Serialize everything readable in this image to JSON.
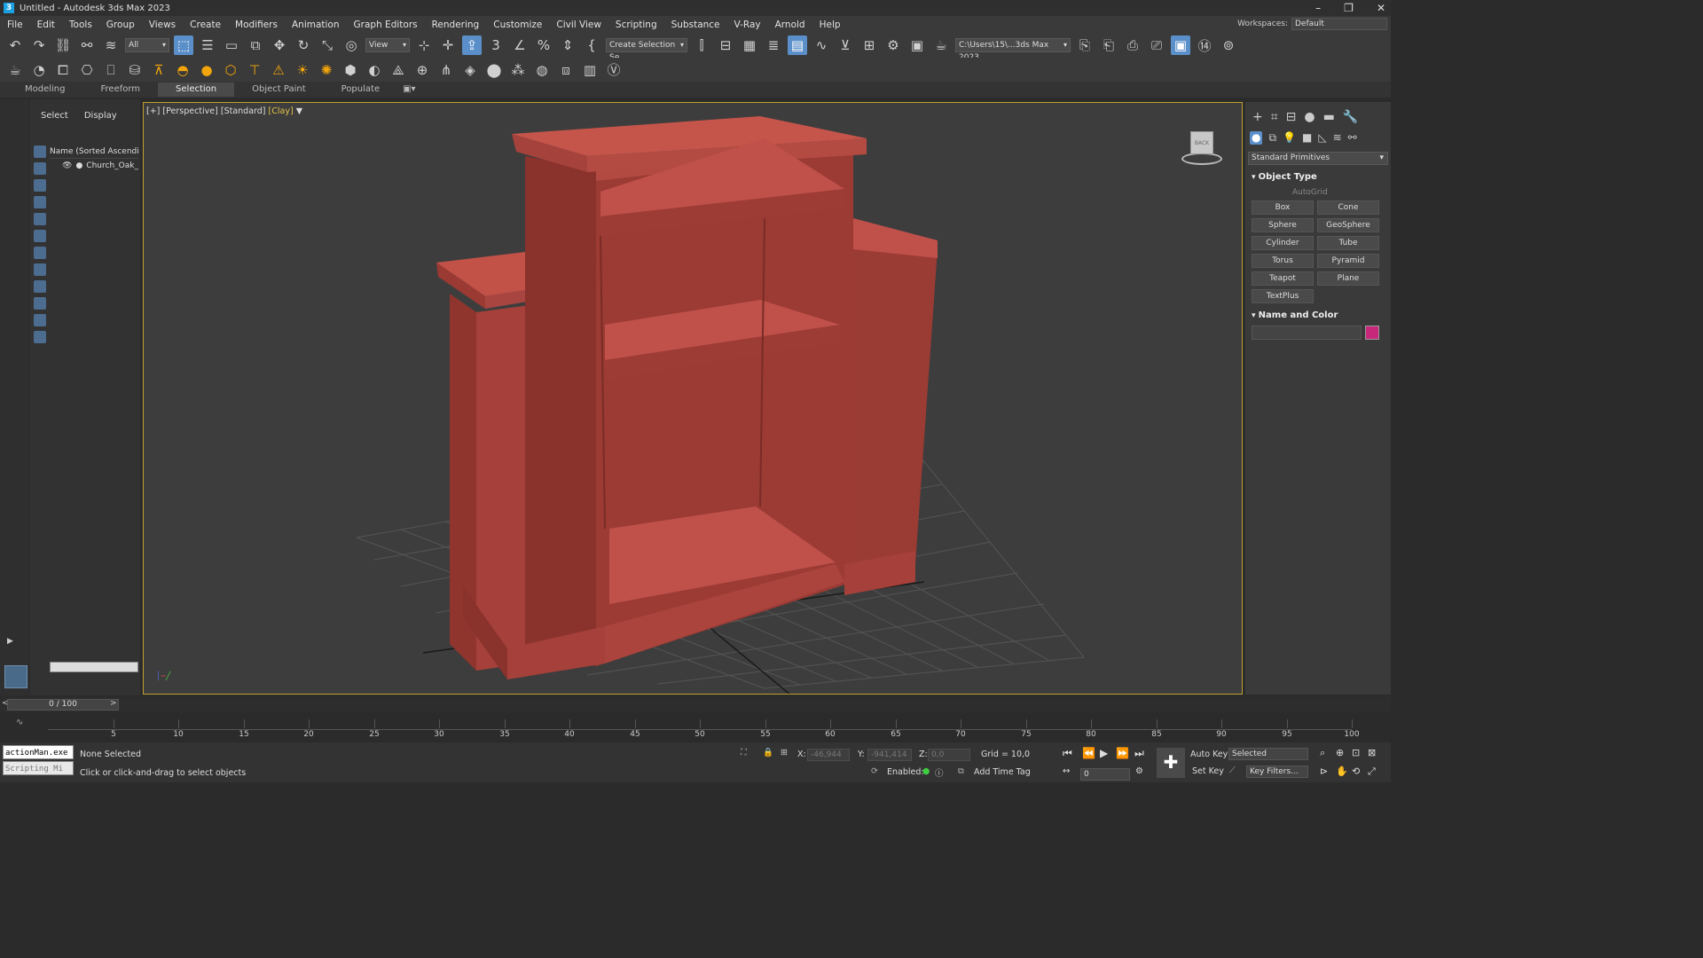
{
  "window": {
    "title": "Untitled - Autodesk 3ds Max 2023",
    "app_icon": "3"
  },
  "menu": [
    "File",
    "Edit",
    "Tools",
    "Group",
    "Views",
    "Create",
    "Modifiers",
    "Animation",
    "Graph Editors",
    "Rendering",
    "Customize",
    "Civil View",
    "Scripting",
    "Substance",
    "V-Ray",
    "Arnold",
    "Help"
  ],
  "workspace": {
    "label": "Workspaces:",
    "value": "Default"
  },
  "toolbar": {
    "selection_filter": "All",
    "ref_coord": "View",
    "named_selection": "Create Selection Se",
    "project_path": "C:\\Users\\15\\...3ds Max 2023"
  },
  "ribbon_tabs": [
    "Modeling",
    "Freeform",
    "Selection",
    "Object Paint",
    "Populate"
  ],
  "ribbon_active": "Selection",
  "explorer": {
    "tabs": [
      "Select",
      "Display"
    ],
    "header": "Name (Sorted Ascending)",
    "items": [
      "Church_Oak_F"
    ]
  },
  "viewport": {
    "label_plus": "[+]",
    "label_view": "[Perspective]",
    "label_shading": "[Standard]",
    "label_style": "[Clay]",
    "viewcube_text": "BACK",
    "model_color": "#b8473e",
    "border_color": "#c0a030"
  },
  "command_panel": {
    "category": "Standard Primitives",
    "object_type_title": "Object Type",
    "autogrid": "AutoGrid",
    "primitives": [
      "Box",
      "Cone",
      "Sphere",
      "GeoSphere",
      "Cylinder",
      "Tube",
      "Torus",
      "Pyramid",
      "Teapot",
      "Plane",
      "TextPlus"
    ],
    "name_color_title": "Name and Color",
    "object_color": "#c8287a"
  },
  "timeline": {
    "frame_display": "0 / 100",
    "ticks": [
      "5",
      "10",
      "15",
      "20",
      "25",
      "30",
      "35",
      "40",
      "45",
      "50",
      "55",
      "60",
      "65",
      "70",
      "75",
      "80",
      "85",
      "90",
      "95",
      "100"
    ]
  },
  "status": {
    "maxscript_line1": "actionMan.exe",
    "maxscript_line2": "Scripting Mi",
    "selection": "None Selected",
    "prompt": "Click or click-and-drag to select objects",
    "x_label": "X:",
    "x_value": "-46,944",
    "y_label": "Y:",
    "y_value": "-941,414",
    "z_label": "Z:",
    "z_value": "0,0",
    "grid": "Grid = 10,0",
    "enabled_label": "Enabled:",
    "add_time_tag": "Add Time Tag",
    "auto_key": "Auto Key",
    "set_key": "Set Key",
    "key_filter_mode": "Selected",
    "key_filters": "Key Filters...",
    "current_frame": "0"
  }
}
